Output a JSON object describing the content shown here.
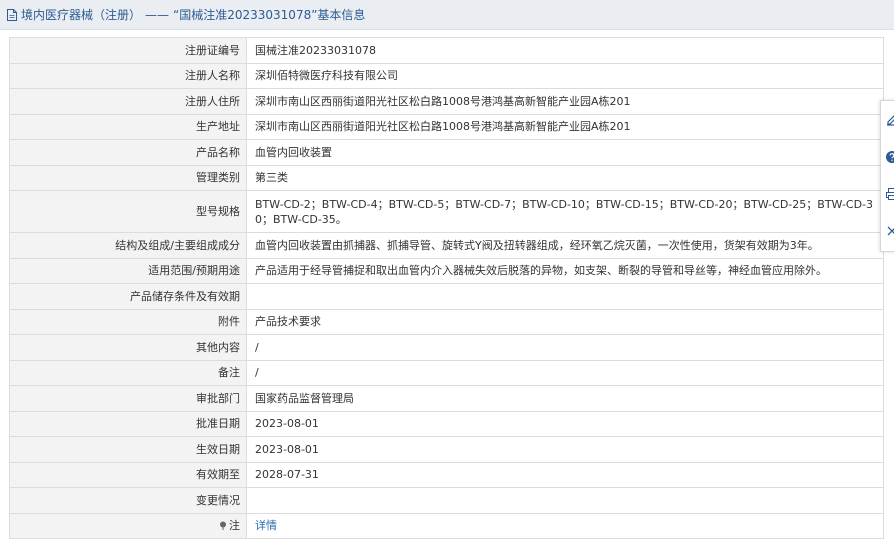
{
  "header": {
    "category": "境内医疗器械（注册）",
    "separator": "——",
    "record_title": "“国械注准20233031078”基本信息"
  },
  "rows": [
    {
      "label": "注册证编号",
      "value": "国械注准20233031078"
    },
    {
      "label": "注册人名称",
      "value": "深圳佰特微医疗科技有限公司"
    },
    {
      "label": "注册人住所",
      "value": "深圳市南山区西丽街道阳光社区松白路1008号港鸿基高新智能产业园A栋201"
    },
    {
      "label": "生产地址",
      "value": "深圳市南山区西丽街道阳光社区松白路1008号港鸿基高新智能产业园A栋201"
    },
    {
      "label": "产品名称",
      "value": "血管内回收装置"
    },
    {
      "label": "管理类别",
      "value": "第三类"
    },
    {
      "label": "型号规格",
      "value": "BTW-CD-2；BTW-CD-4；BTW-CD-5；BTW-CD-7；BTW-CD-10；BTW-CD-15；BTW-CD-20；BTW-CD-25；BTW-CD-30；BTW-CD-35。"
    },
    {
      "label": "结构及组成/主要组成成分",
      "value": "血管内回收装置由抓捕器、抓捕导管、旋转式Y阀及扭转器组成，经环氧乙烷灭菌，一次性使用，货架有效期为3年。"
    },
    {
      "label": "适用范围/预期用途",
      "value": "产品适用于经导管捕捉和取出血管内介入器械失效后脱落的异物，如支架、断裂的导管和导丝等，神经血管应用除外。"
    },
    {
      "label": "产品储存条件及有效期",
      "value": ""
    },
    {
      "label": "附件",
      "value": "产品技术要求"
    },
    {
      "label": "其他内容",
      "value": "/"
    },
    {
      "label": "备注",
      "value": "/"
    },
    {
      "label": "审批部门",
      "value": "国家药品监督管理局"
    },
    {
      "label": "批准日期",
      "value": "2023-08-01"
    },
    {
      "label": "生效日期",
      "value": "2023-08-01"
    },
    {
      "label": "有效期至",
      "value": "2028-07-31"
    },
    {
      "label": "变更情况",
      "value": ""
    }
  ],
  "note_row": {
    "label": "注",
    "link_text": "详情"
  },
  "toolbar": {
    "icons": [
      "edit-icon",
      "help-icon",
      "print-icon",
      "close-icon"
    ]
  },
  "colors": {
    "header_bg": "#eaeef2",
    "header_text": "#2c5b93",
    "label_bg": "#f3f3f3",
    "border": "#dcdcdc",
    "link": "#2a6bb0"
  }
}
